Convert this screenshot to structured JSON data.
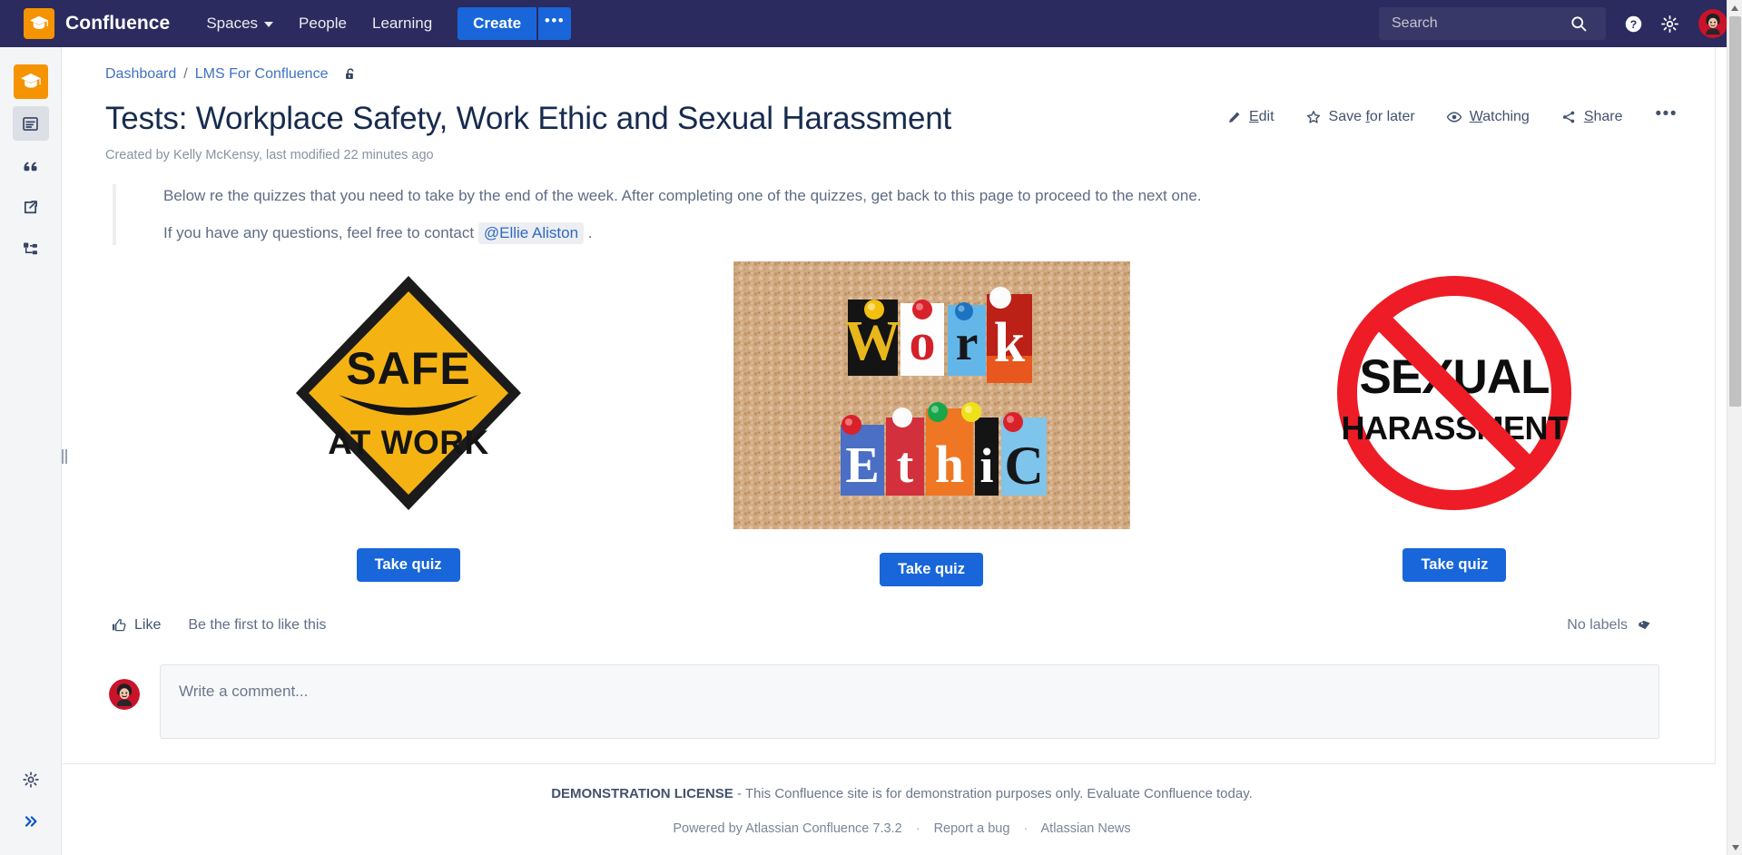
{
  "nav": {
    "brand": "Confluence",
    "logo_icon": "graduation-cap-icon",
    "links": [
      {
        "label": "Spaces",
        "has_caret": true
      },
      {
        "label": "People",
        "has_caret": false
      },
      {
        "label": "Learning",
        "has_caret": false
      }
    ],
    "create_label": "Create",
    "create_more_label": "•••",
    "search_placeholder": "Search",
    "search_value": "",
    "search_icon": "search-icon",
    "help_icon": "help-circle-icon",
    "settings_icon": "gear-icon",
    "avatar_icon": "user-avatar"
  },
  "rail": {
    "space_logo_icon": "graduation-cap-icon",
    "items": [
      {
        "icon": "page-icon",
        "name": "sidebar-item-pages",
        "active": true
      },
      {
        "icon": "blockquote-icon",
        "name": "sidebar-item-blog",
        "active": false
      },
      {
        "icon": "external-link-icon",
        "name": "sidebar-item-shortcuts",
        "active": false
      },
      {
        "icon": "page-tree-icon",
        "name": "sidebar-item-page-tree",
        "active": false
      }
    ],
    "bottom": [
      {
        "icon": "gear-icon",
        "name": "sidebar-space-settings"
      },
      {
        "icon": "chevron-double-right-icon",
        "name": "sidebar-expand"
      }
    ]
  },
  "breadcrumb": {
    "items": [
      "Dashboard",
      "LMS For Confluence"
    ],
    "separator": "/",
    "restriction_icon": "unlocked-padlock-icon"
  },
  "page": {
    "title": "Tests: Workplace Safety, Work Ethic and Sexual Harassment",
    "byline": "Created by Kelly McKensy, last modified 22 minutes ago"
  },
  "actions": [
    {
      "label": "Edit",
      "icon": "pencil-icon",
      "name": "edit-button"
    },
    {
      "label": "Save for later",
      "icon": "star-icon",
      "name": "save-for-later-button"
    },
    {
      "label": "Watching",
      "icon": "eye-icon",
      "name": "watching-button"
    },
    {
      "label": "Share",
      "icon": "share-icon",
      "name": "share-button"
    }
  ],
  "actions_more_label": "•••",
  "body": {
    "paragraph_1": "Below re the quizzes that you need to take by the end of the week. After completing one of the quizzes, get back to this page to proceed to the next one.",
    "paragraph_2_before": "If you have any questions, feel free to contact",
    "mention": "@Ellie Aliston",
    "paragraph_2_after": "."
  },
  "quizzes": [
    {
      "image_alt": "SAFE AT WORK yellow diamond safety sign",
      "image_text_top": "SAFE",
      "image_text_bottom": "AT WORK",
      "button_label": "Take quiz"
    },
    {
      "image_alt": "Work Ethic cut-out letters pinned on a cork board",
      "image_text_top": "Work",
      "image_text_bottom": "Ethic",
      "button_label": "Take quiz"
    },
    {
      "image_alt": "No sexual harassment red prohibition sign",
      "image_text_top": "SEXUAL",
      "image_text_bottom": "HARASSMENT",
      "button_label": "Take quiz"
    }
  ],
  "meta": {
    "like_label": "Like",
    "like_icon": "thumbs-up-icon",
    "like_note": "Be the first to like this",
    "labels_label": "No labels",
    "labels_icon": "tag-icon"
  },
  "comment": {
    "placeholder": "Write a comment...",
    "avatar_icon": "user-avatar"
  },
  "footer": {
    "license_bold": "DEMONSTRATION LICENSE",
    "license_text": "- This Confluence site is for demonstration purposes only. Evaluate Confluence today.",
    "powered_by": "Powered by Atlassian Confluence 7.3.2",
    "links": [
      "Report a bug",
      "Atlassian News"
    ],
    "separator": "·"
  },
  "colors": {
    "nav_bg": "#2b2b5f",
    "primary_blue": "#1866d9",
    "link_blue": "#3f72c0",
    "logo_orange": "#f59300",
    "text_dark": "#172b4d",
    "text_muted": "#5e6c84"
  }
}
